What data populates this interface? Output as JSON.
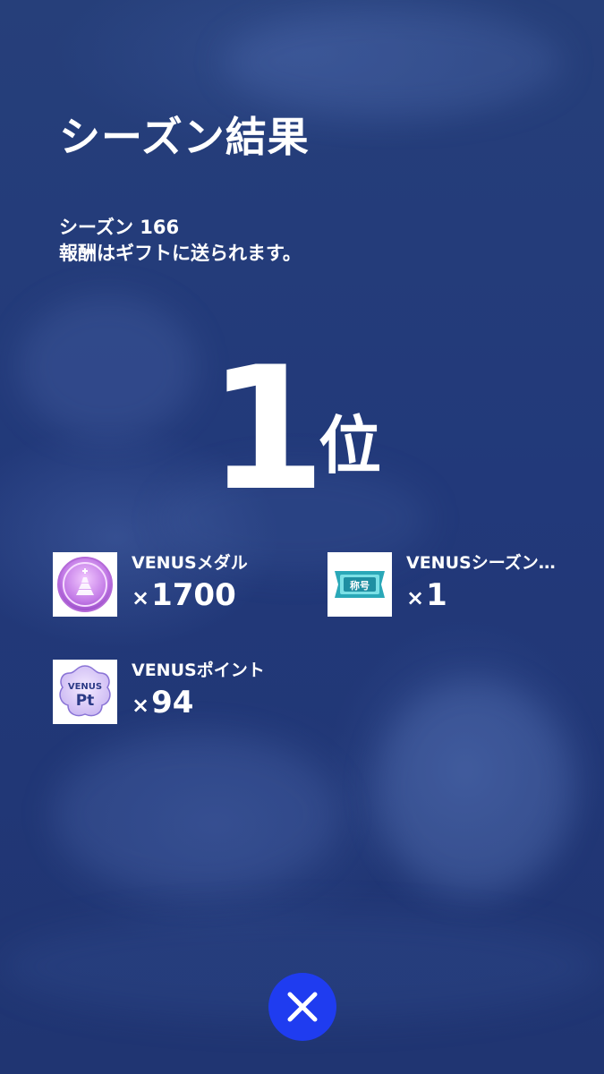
{
  "title": "シーズン結果",
  "season_line": "シーズン 166",
  "info_line": "報酬はギフトに送られます。",
  "rank": {
    "number": "1",
    "suffix": "位"
  },
  "rewards": [
    {
      "name": "VENUSメダル",
      "qty_prefix": "×",
      "qty": "1700",
      "icon": "venus-medal-icon"
    },
    {
      "name": "VENUSシーズン…",
      "qty_prefix": "×",
      "qty": "1",
      "icon": "title-ticket-icon",
      "icon_text": "称号"
    },
    {
      "name": "VENUSポイント",
      "qty_prefix": "×",
      "qty": "94",
      "icon": "venus-point-icon",
      "icon_text_top": "VENUS",
      "icon_text_bottom": "Pt"
    }
  ],
  "close_icon": "close-icon",
  "colors": {
    "background": "#223a74",
    "close_button": "#1f3cf0",
    "text": "#ffffff"
  }
}
